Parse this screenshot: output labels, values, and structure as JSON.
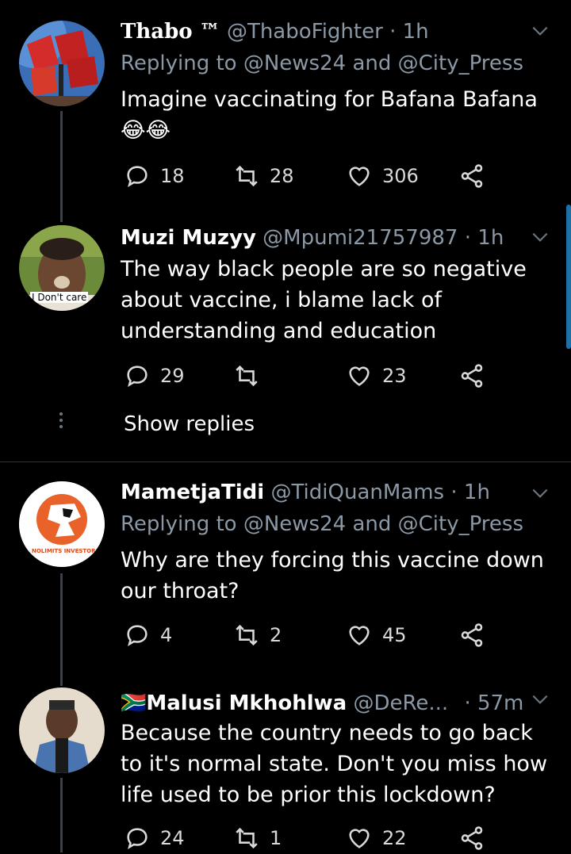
{
  "tweets": [
    {
      "display_name": "Thabo ™",
      "handle": "@ThaboFighter",
      "time": "· 1h",
      "replying_to": "Replying to @News24 and @City_Press",
      "text": "Imagine vaccinating for Bafana Bafana",
      "emoji": "😂😂",
      "replies": "18",
      "retweets": "28",
      "likes": "306"
    },
    {
      "display_name": "Muzi Muzyy",
      "handle": "@Mpumi21757987",
      "time": "· 1h",
      "text": "The way black people are so negative about vaccine, i blame lack of understanding and education",
      "avatar_caption": "I Don't care",
      "replies": "29",
      "retweets": "",
      "likes": "23"
    },
    {
      "display_name": "MametjaTidi",
      "handle": "@TidiQuanMams",
      "time": "· 1h",
      "replying_to": "Replying to @News24 and @City_Press",
      "text": "Why are they forcing this vaccine down our throat?",
      "avatar_caption": "NOLIMITS INVESTORS",
      "replies": "4",
      "retweets": "2",
      "likes": "45"
    },
    {
      "display_name": "Malusi Mkhohlwa",
      "flag": "🇿🇦",
      "handle": "@DeRe...",
      "time": "· 57m",
      "text": "Because the country needs to go back to it's normal state. Don't you miss how life used to be prior this lockdown?",
      "replies": "24",
      "retweets": "1",
      "likes": "22"
    }
  ],
  "show_replies_label": "Show replies",
  "colors": {
    "background": "#000000",
    "secondary_text": "#8b98a5",
    "divider": "#2f3336",
    "thread_line": "#3d4145"
  }
}
